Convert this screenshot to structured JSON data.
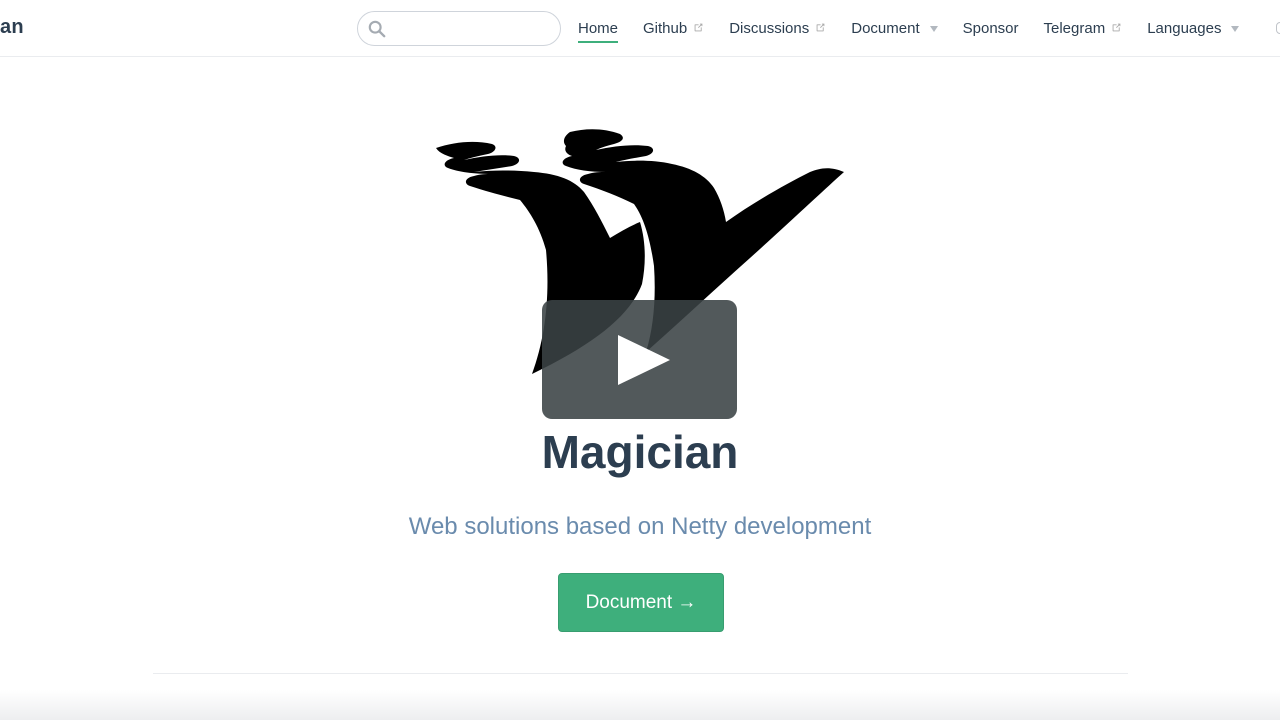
{
  "navbar": {
    "site_name": "an",
    "search": {
      "value": "",
      "placeholder": ""
    },
    "links": [
      {
        "label": "Home",
        "active": true,
        "external": false,
        "dropdown": false
      },
      {
        "label": "Github",
        "active": false,
        "external": true,
        "dropdown": false
      },
      {
        "label": "Discussions",
        "active": false,
        "external": true,
        "dropdown": false
      },
      {
        "label": "Document",
        "active": false,
        "external": false,
        "dropdown": true
      },
      {
        "label": "Sponsor",
        "active": false,
        "external": false,
        "dropdown": false
      },
      {
        "label": "Telegram",
        "active": false,
        "external": true,
        "dropdown": false
      },
      {
        "label": "Languages",
        "active": false,
        "external": false,
        "dropdown": true
      }
    ]
  },
  "hero": {
    "title": "Magician",
    "description": "Web solutions based on Netty development",
    "action_label": "Document →",
    "logo_icon": "magician-hands-logo",
    "overlay_icon": "play-icon"
  },
  "colors": {
    "accent": "#3eaf7c",
    "text": "#2c3e50",
    "description": "#6a8bad",
    "border": "#eaecef"
  }
}
